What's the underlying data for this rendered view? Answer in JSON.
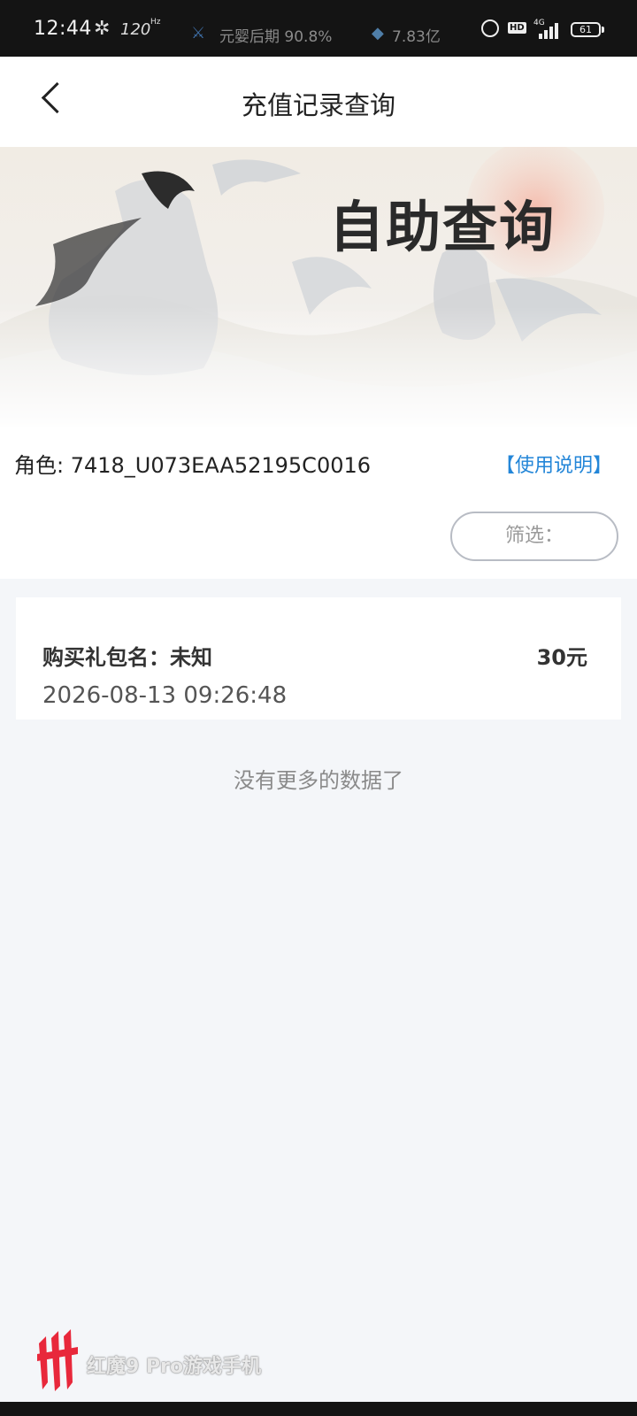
{
  "status_bar": {
    "time": "12:44",
    "refresh": "120",
    "refresh_unit": "Hz",
    "stage": "元婴后期 90.8%",
    "wealth": "7.83亿",
    "net": "4G",
    "battery": "61"
  },
  "header": {
    "title": "充值记录查询"
  },
  "banner": {
    "title": "自助查询"
  },
  "info": {
    "role": "角色: 7418_U073EAA52195C0016",
    "help": "【使用说明】",
    "filter": "筛选："
  },
  "records": [
    {
      "name": "购买礼包名：未知",
      "amount": "30元",
      "date": "2026-08-13 09:26:48"
    }
  ],
  "no_more": "没有更多的数据了",
  "watermark": "红魔9 Pro游戏手机",
  "colors": {
    "accent_link": "#2386d8",
    "page_bg": "#f4f6f9",
    "status_bar_bg": "#141414",
    "brand_red": "#e8283b"
  }
}
